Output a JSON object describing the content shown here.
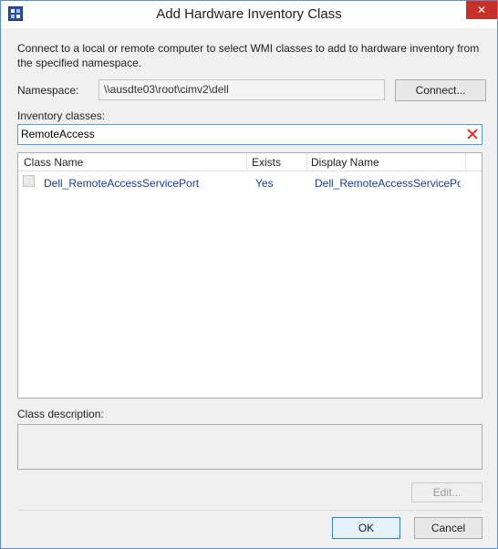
{
  "window": {
    "title": "Add Hardware Inventory Class",
    "close_glyph": "✕"
  },
  "description": "Connect to a local or remote computer to select WMI classes to add to hardware inventory from the specified namespace.",
  "namespace": {
    "label": "Namespace:",
    "value": "\\\\ausdte03\\root\\cimv2\\dell",
    "connect_label": "Connect..."
  },
  "inventory": {
    "label": "Inventory classes:",
    "search_value": "RemoteAccess"
  },
  "list": {
    "columns": [
      "Class Name",
      "Exists",
      "Display Name"
    ],
    "rows": [
      {
        "class_name": "Dell_RemoteAccessServicePort",
        "exists": "Yes",
        "display_name": "Dell_RemoteAccessServicePor",
        "checked": false
      }
    ]
  },
  "class_description": {
    "label": "Class description:",
    "value": ""
  },
  "buttons": {
    "edit": "Edit...",
    "ok": "OK",
    "cancel": "Cancel"
  },
  "colors": {
    "accent": "#5b9bd5",
    "close": "#c7312c",
    "link_text": "#1f3a8f"
  },
  "icons": {
    "app": "hardware-inventory-icon",
    "clear": "red-x-clear-icon"
  }
}
